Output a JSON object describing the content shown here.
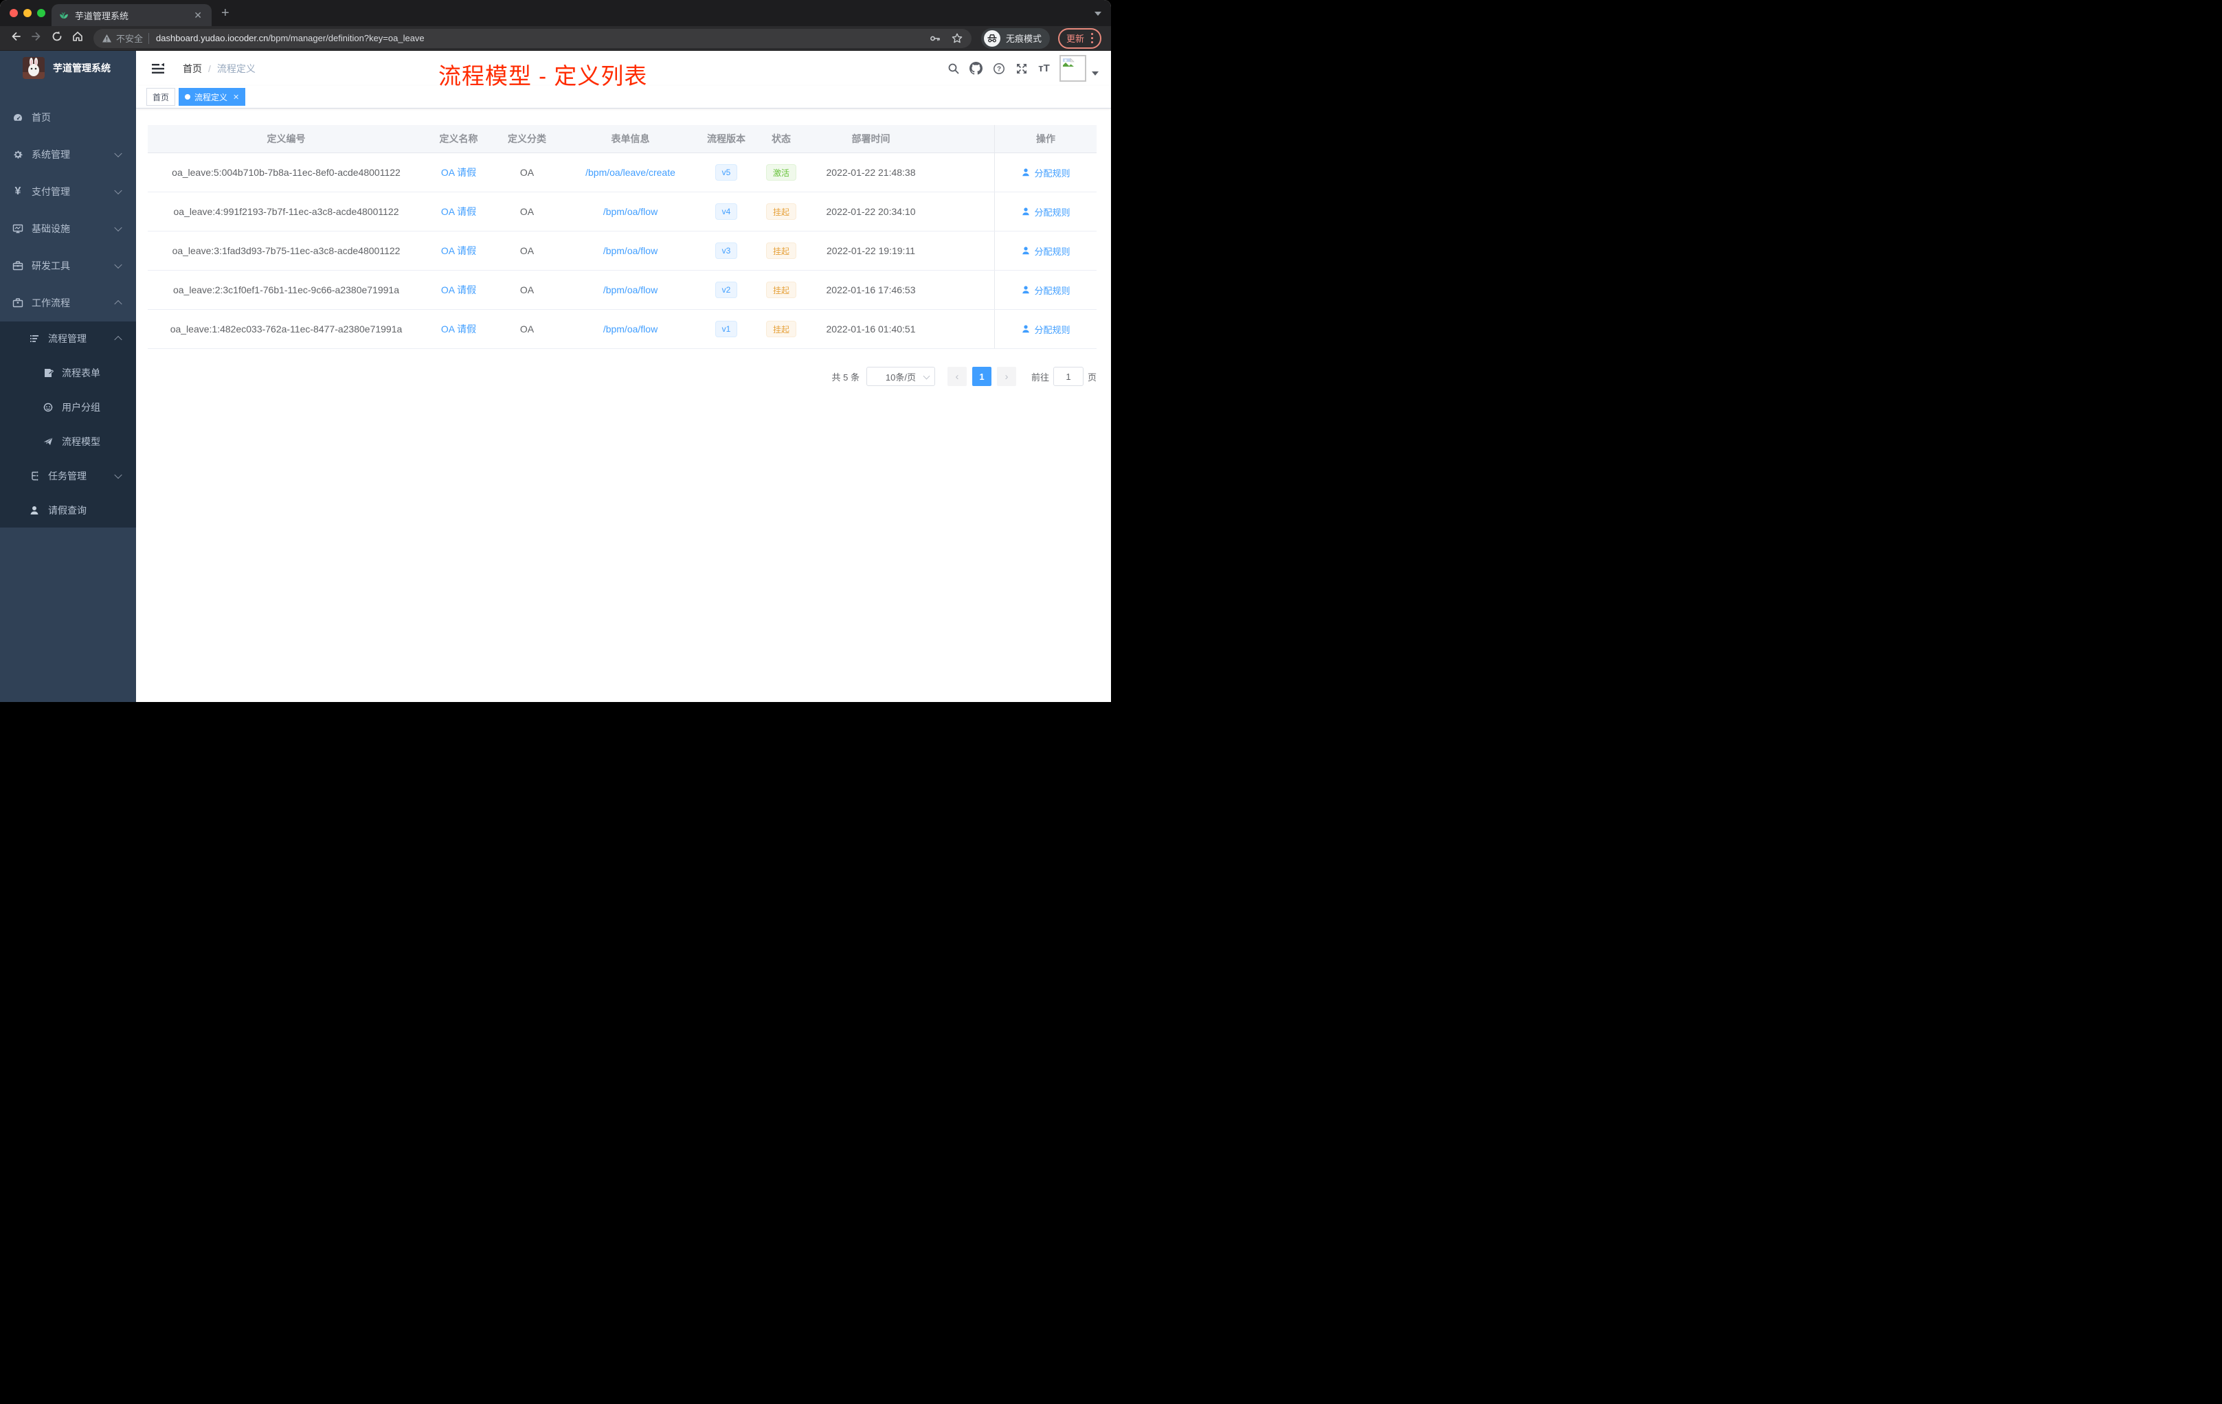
{
  "browser": {
    "tab_title": "芋道管理系统",
    "security_label": "不安全",
    "url_domain": "dashboard.yudao.iocoder.cn",
    "url_path": "/bpm/manager/definition?key=oa_leave",
    "incognito_label": "无痕模式",
    "update_label": "更新"
  },
  "sidebar": {
    "title": "芋道管理系统",
    "items": {
      "home": "首页",
      "system": "系统管理",
      "pay": "支付管理",
      "infra": "基础设施",
      "dev": "研发工具",
      "workflow": "工作流程",
      "process_mgmt": "流程管理",
      "process_form": "流程表单",
      "user_group": "用户分组",
      "process_model": "流程模型",
      "task_mgmt": "任务管理",
      "leave_query": "请假查询"
    }
  },
  "header": {
    "breadcrumb": {
      "home": "首页",
      "current": "流程定义"
    }
  },
  "tags": {
    "home": "首页",
    "active": "流程定义"
  },
  "annotation": "流程模型 - 定义列表",
  "table": {
    "columns": {
      "id": "定义编号",
      "name": "定义名称",
      "category": "定义分类",
      "form": "表单信息",
      "version": "流程版本",
      "status": "状态",
      "time": "部署时间",
      "action": "操作"
    },
    "action_label": "分配规则",
    "rows": [
      {
        "id": "oa_leave:5:004b710b-7b8a-11ec-8ef0-acde48001122",
        "name": "OA 请假",
        "category": "OA",
        "form": "/bpm/oa/leave/create",
        "version": "v5",
        "status": "激活",
        "time": "2022-01-22 21:48:38"
      },
      {
        "id": "oa_leave:4:991f2193-7b7f-11ec-a3c8-acde48001122",
        "name": "OA 请假",
        "category": "OA",
        "form": "/bpm/oa/flow",
        "version": "v4",
        "status": "挂起",
        "time": "2022-01-22 20:34:10"
      },
      {
        "id": "oa_leave:3:1fad3d93-7b75-11ec-a3c8-acde48001122",
        "name": "OA 请假",
        "category": "OA",
        "form": "/bpm/oa/flow",
        "version": "v3",
        "status": "挂起",
        "time": "2022-01-22 19:19:11"
      },
      {
        "id": "oa_leave:2:3c1f0ef1-76b1-11ec-9c66-a2380e71991a",
        "name": "OA 请假",
        "category": "OA",
        "form": "/bpm/oa/flow",
        "version": "v2",
        "status": "挂起",
        "time": "2022-01-16 17:46:53"
      },
      {
        "id": "oa_leave:1:482ec033-762a-11ec-8477-a2380e71991a",
        "name": "OA 请假",
        "category": "OA",
        "form": "/bpm/oa/flow",
        "version": "v1",
        "status": "挂起",
        "time": "2022-01-16 01:40:51"
      }
    ]
  },
  "pagination": {
    "total": "共 5 条",
    "page_size": "10条/页",
    "current": "1",
    "goto": "前往",
    "goto_value": "1",
    "page_unit": "页"
  },
  "colors": {
    "accent": "#409eff",
    "annotation_red": "#ff2b00",
    "status_active_green": "#67c23a",
    "status_suspended_orange": "#e6a23c",
    "sidebar_bg": "#304156",
    "submenu_bg": "#1f2d3d"
  }
}
